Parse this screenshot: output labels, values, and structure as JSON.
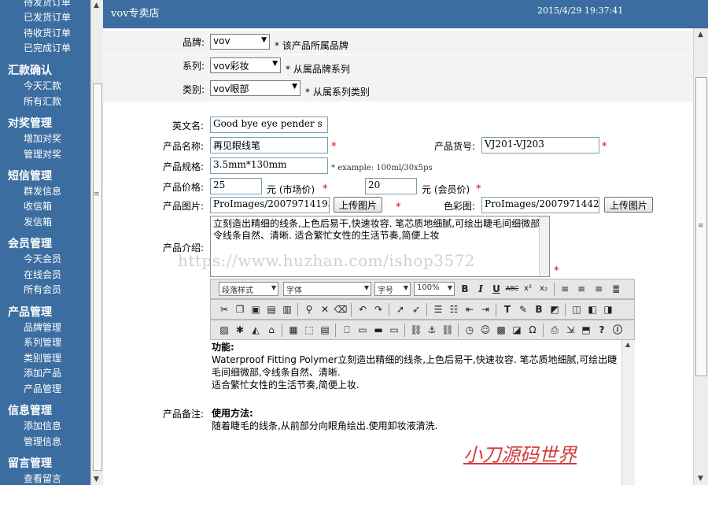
{
  "sidebar": {
    "top_items": [
      "待发货订单",
      "已发货订单",
      "待收货订单",
      "已完成订单"
    ],
    "sections": [
      {
        "title": "汇款确认",
        "items": [
          "今天汇款",
          "所有汇款"
        ]
      },
      {
        "title": "对奖管理",
        "items": [
          "增加对奖",
          "管理对奖"
        ]
      },
      {
        "title": "短信管理",
        "items": [
          "群发信息",
          "收信箱",
          "发信箱"
        ]
      },
      {
        "title": "会员管理",
        "items": [
          "今天会员",
          "在线会员",
          "所有会员"
        ]
      },
      {
        "title": "产品管理",
        "items": [
          "品牌管理",
          "系列管理",
          "类别管理",
          "添加产品",
          "产品管理"
        ]
      },
      {
        "title": "信息管理",
        "items": [
          "添加信息",
          "管理信息"
        ]
      },
      {
        "title": "留言管理",
        "items": [
          "查看留言"
        ]
      }
    ]
  },
  "header": {
    "store_title": "vov专卖店",
    "datetime": "2015/4/29 19:37:41"
  },
  "form": {
    "brand": {
      "label": "品牌:",
      "value": "vov",
      "note": "* 该产品所属品牌"
    },
    "series": {
      "label": "系列:",
      "value": "vov彩妆",
      "note": "* 从属品牌系列"
    },
    "category": {
      "label": "类别:",
      "value": "vov眼部",
      "note": "* 从属系列类别"
    },
    "english_name": {
      "label": "英文名:",
      "value": "Good bye eye pender s"
    },
    "product_name": {
      "label": "产品名称:",
      "value": "再见眼线笔"
    },
    "product_no": {
      "label": "产品货号:",
      "value": "VJ201-VJ203"
    },
    "spec": {
      "label": "产品规格:",
      "value": "3.5mm*130mm",
      "example": "* example: 100ml/30x5ps"
    },
    "price": {
      "label": "产品价格:",
      "market_value": "25",
      "market_unit": "元 (市场价)",
      "member_value": "20",
      "member_unit": "元 (会员价)"
    },
    "image": {
      "label": "产品图片:",
      "value": "ProImages/20079714195",
      "button": "上传图片"
    },
    "color_image": {
      "label": "色彩图:",
      "value": "ProImages/20079714421",
      "button": "上传图片"
    },
    "intro": {
      "label": "产品介绍:",
      "text": "立刻造出精细的线条,上色后易干,快速妆容. 笔芯质地细腻,可绘出睫毛间细微部,令线条自然、清晰. 适合繁忙女性的生活节奏,简便上妆"
    },
    "remark": {
      "label": "产品备注:"
    },
    "star": "*"
  },
  "watermark": "https://www.huzhan.com/ishop3572",
  "editor": {
    "format_select": "段落样式",
    "font_select": "字体",
    "size_select": "字号",
    "zoom_select": "100%",
    "content": {
      "heading1": "功能:",
      "para1": "Waterproof Fitting Polymer立刻造出精细的线条,上色后易干,快速妆容. 笔芯质地细腻,可绘出睫毛间细微部,令线条自然、清晰.",
      "para2": "适合繁忙女性的生活节奏,简便上妆.",
      "heading2": "使用方法:",
      "para3": "随着睫毛的线条,从前部分向眼角绘出.使用卸妆液清洗."
    }
  },
  "signature": "小刀源码世界",
  "colors": {
    "nav_bg": "#3b6da0",
    "required_star": "#dd0000",
    "signature": "#d23a3a"
  },
  "icons": {
    "toolbar_row2": [
      "cut-icon",
      "copy-icon",
      "paste-icon",
      "paste-text-icon",
      "paste-word-icon",
      "find-icon",
      "delete-icon",
      "eraser-icon",
      "undo-icon",
      "redo-icon",
      "select-icon",
      "select-all-icon",
      "ordered-list-icon",
      "unordered-list-icon",
      "outdent-icon",
      "indent-icon",
      "text-color-icon",
      "highlight-icon",
      "bg-color-icon",
      "abs-position-icon",
      "layer-front-icon",
      "layer-back-icon",
      "layer-icon"
    ],
    "toolbar_row3": [
      "image-icon",
      "flash-icon",
      "media-icon",
      "special-icon",
      "table-icon",
      "form-icon",
      "frame-icon",
      "fieldset-icon",
      "marquee-icon",
      "button-icon",
      "link-icon",
      "anchor-icon",
      "unlink-icon",
      "time-icon",
      "emoticon-icon",
      "paste-image-icon",
      "remote-image-icon",
      "symbol-icon",
      "print-icon",
      "page-break-icon",
      "help-icon",
      "info-icon"
    ]
  }
}
